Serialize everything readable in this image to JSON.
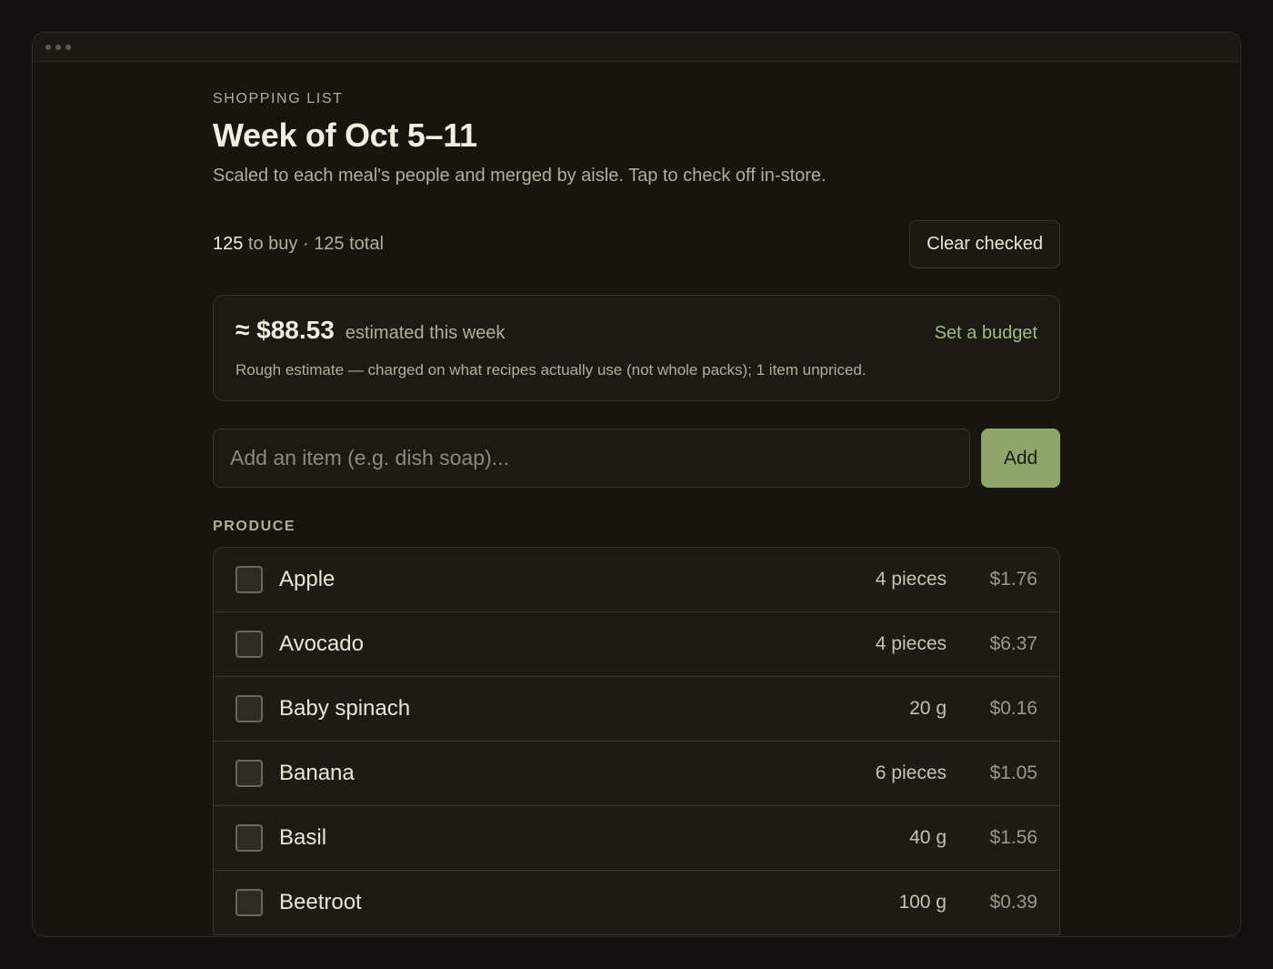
{
  "header": {
    "eyebrow": "SHOPPING LIST",
    "title": "Week of Oct 5–11",
    "subtitle": "Scaled to each meal's people and merged by aisle. Tap to check off in-store."
  },
  "summary": {
    "to_buy_count": "125",
    "to_buy_label": " to buy · 125 total",
    "clear_checked_label": "Clear checked"
  },
  "estimate": {
    "amount": "≈ $88.53",
    "label": "estimated this week",
    "budget_link": "Set a budget",
    "note": "Rough estimate — charged on what recipes actually use (not whole packs); 1 item unpriced."
  },
  "add_item": {
    "placeholder": "Add an item (e.g. dish soap)...",
    "button_label": "Add"
  },
  "sections": [
    {
      "title": "PRODUCE",
      "items": [
        {
          "name": "Apple",
          "qty": "4 pieces",
          "price": "$1.76",
          "checked": false
        },
        {
          "name": "Avocado",
          "qty": "4 pieces",
          "price": "$6.37",
          "checked": false
        },
        {
          "name": "Baby spinach",
          "qty": "20 g",
          "price": "$0.16",
          "checked": false
        },
        {
          "name": "Banana",
          "qty": "6 pieces",
          "price": "$1.05",
          "checked": false
        },
        {
          "name": "Basil",
          "qty": "40 g",
          "price": "$1.56",
          "checked": false
        },
        {
          "name": "Beetroot",
          "qty": "100 g",
          "price": "$0.39",
          "checked": false
        }
      ]
    }
  ]
}
